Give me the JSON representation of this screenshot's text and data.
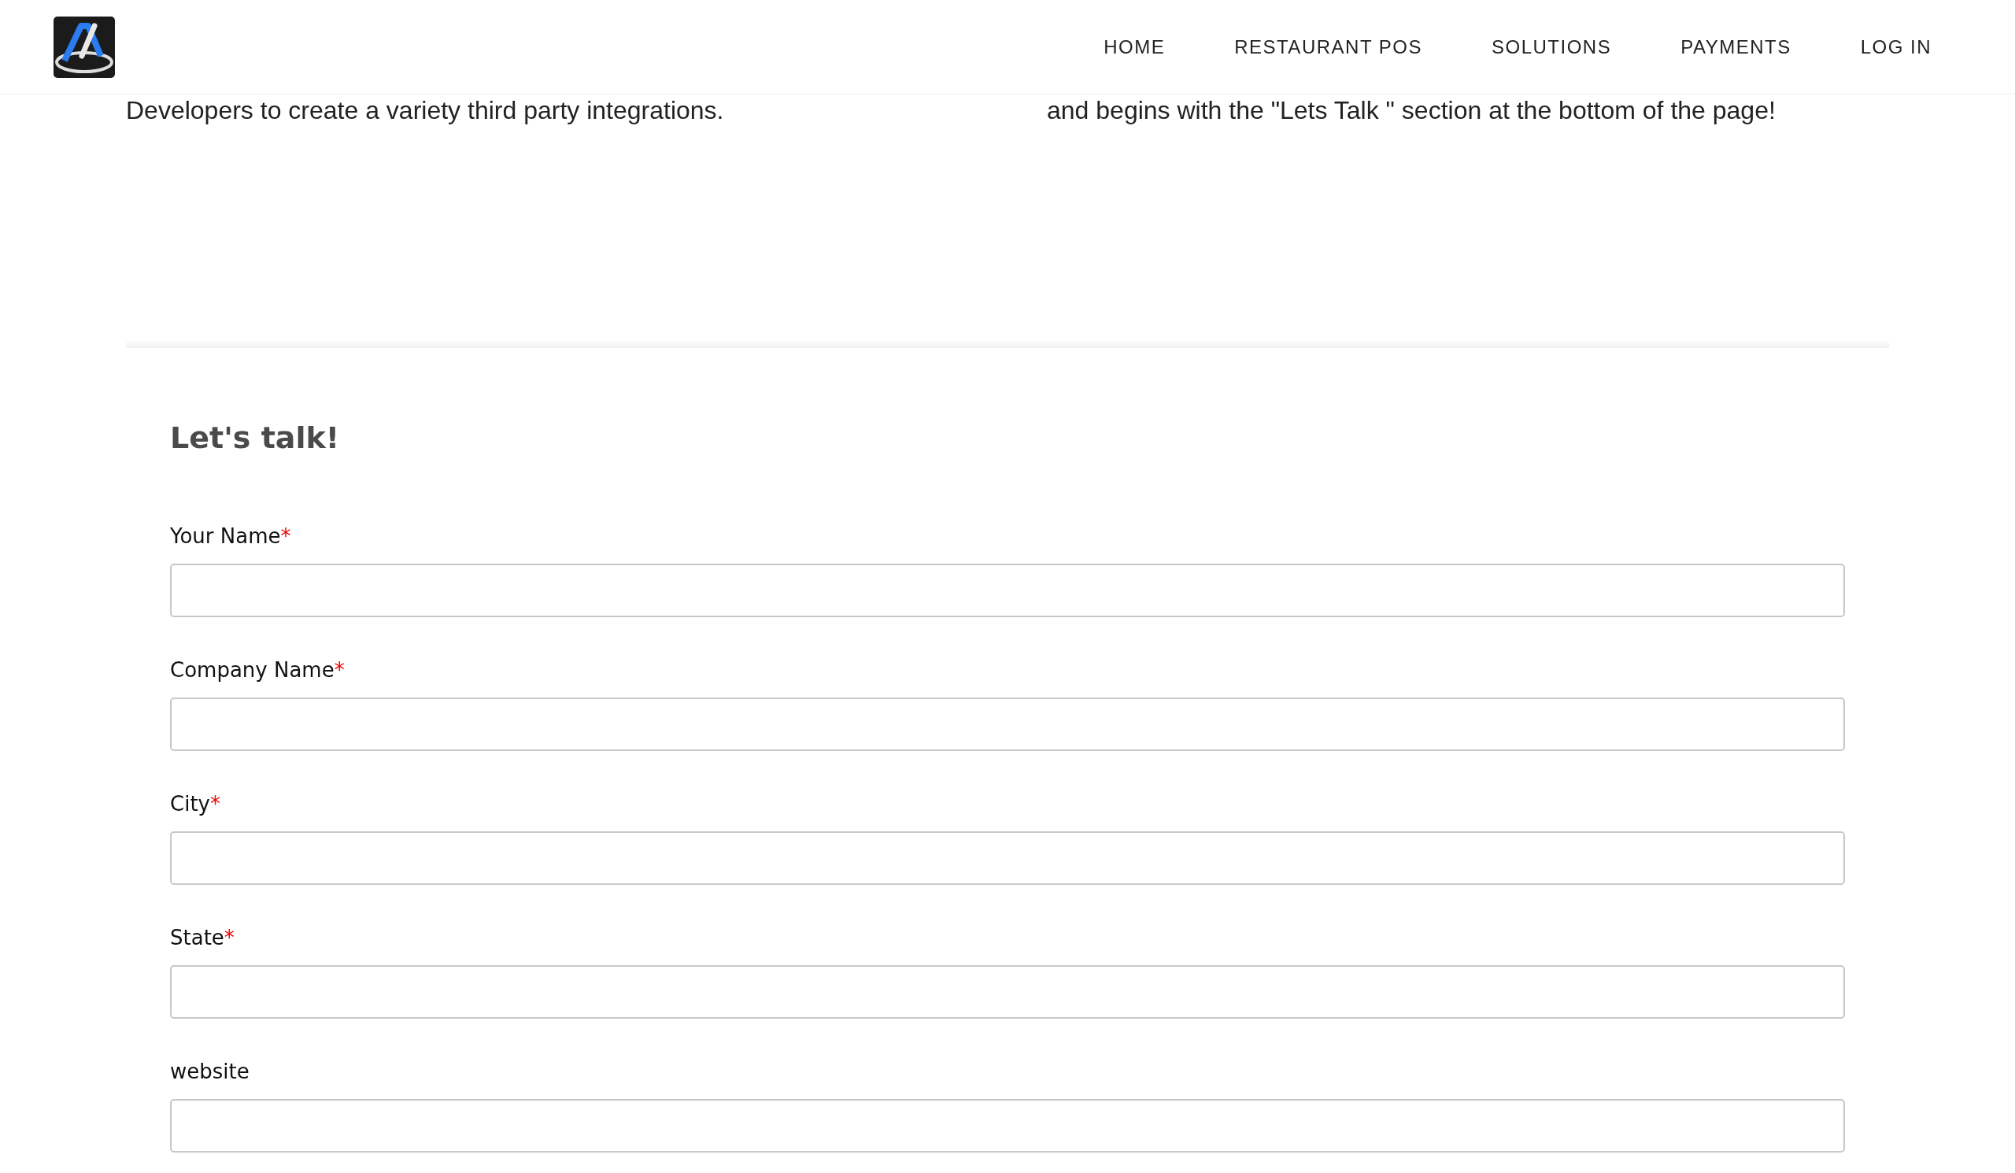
{
  "nav": {
    "items": [
      "HOME",
      "RESTAURANT POS",
      "SOLUTIONS",
      "PAYMENTS",
      "LOG IN"
    ]
  },
  "intro": {
    "left": "Developers to create a variety third party integrations.",
    "right": "and begins with the \"Lets Talk \" section at the bottom of the page!"
  },
  "form": {
    "title": "Let's talk!",
    "fields": [
      {
        "label": "Your Name",
        "required_mark": "*"
      },
      {
        "label": "Company Name",
        "required_mark": "*"
      },
      {
        "label": "City",
        "required_mark": "*"
      },
      {
        "label": "State",
        "required_mark": "*"
      },
      {
        "label": "website"
      }
    ]
  }
}
